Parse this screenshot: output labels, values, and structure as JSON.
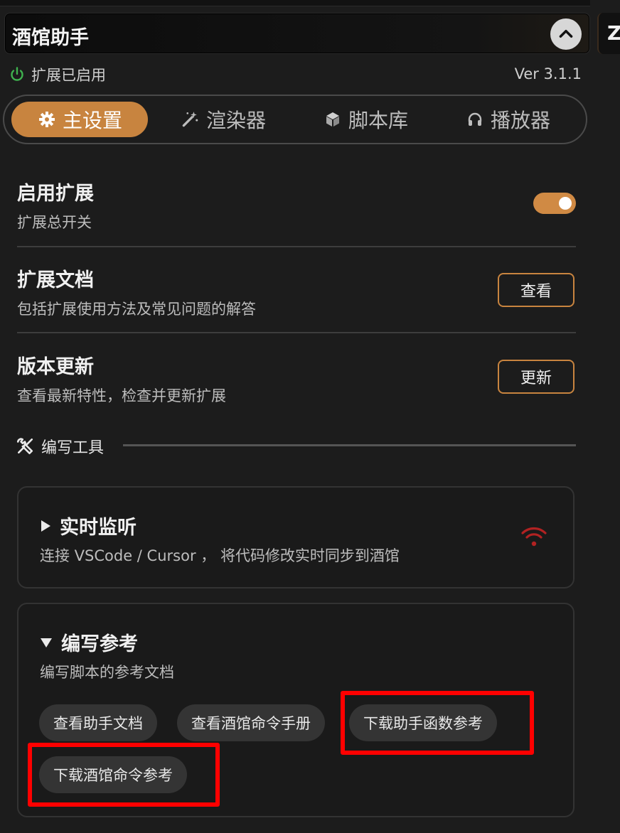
{
  "header": {
    "title": "酒馆助手",
    "right_panel_label": "Ze"
  },
  "status": {
    "text": "扩展已启用",
    "version": "Ver 3.1.1"
  },
  "tabs": [
    {
      "label": "主设置",
      "icon": "gear-icon"
    },
    {
      "label": "渲染器",
      "icon": "magic-wand-icon"
    },
    {
      "label": "脚本库",
      "icon": "cube-icon"
    },
    {
      "label": "播放器",
      "icon": "headphones-icon"
    }
  ],
  "settings": [
    {
      "title": "启用扩展",
      "desc": "扩展总开关"
    },
    {
      "title": "扩展文档",
      "desc": "包括扩展使用方法及常见问题的解答",
      "button": "查看"
    },
    {
      "title": "版本更新",
      "desc": "查看最新特性，检查并更新扩展",
      "button": "更新"
    }
  ],
  "tools_section": {
    "title": "编写工具"
  },
  "cards": [
    {
      "title": "实时监听",
      "desc": "连接 VSCode / Cursor ， 将代码修改实时同步到酒馆"
    },
    {
      "title": "编写参考",
      "desc": "编写脚本的参考文档",
      "buttons": [
        "查看助手文档",
        "查看酒馆命令手册",
        "下载助手函数参考",
        "下载酒馆命令参考"
      ]
    }
  ],
  "colors": {
    "accent": "#c8843f",
    "background": "#1c1c1c",
    "highlight": "#ff0000",
    "wifi": "#b22222"
  }
}
